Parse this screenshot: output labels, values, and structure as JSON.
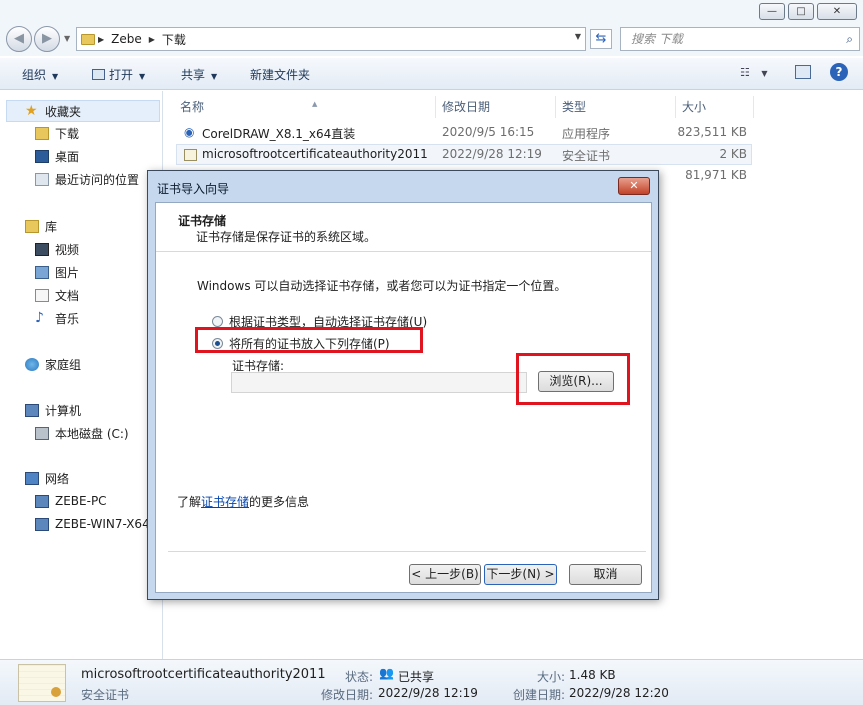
{
  "window": {
    "minimize": "—",
    "maximize": "□",
    "close": "✕"
  },
  "address": {
    "crumbs": [
      "Zebe",
      "下载"
    ],
    "search_placeholder": "搜索 下载"
  },
  "toolbar": {
    "organize": "组织",
    "open": "打开",
    "share": "共享",
    "new_folder": "新建文件夹"
  },
  "sidebar": {
    "favorites": "收藏夹",
    "downloads": "下载",
    "desktop": "桌面",
    "recent": "最近访问的位置",
    "libraries": "库",
    "videos": "视频",
    "pictures": "图片",
    "documents": "文档",
    "music": "音乐",
    "homegroup": "家庭组",
    "computer": "计算机",
    "local_disk": "本地磁盘 (C:)",
    "network": "网络",
    "pc1": "ZEBE-PC",
    "pc2": "ZEBE-WIN7-X64"
  },
  "columns": {
    "name": "名称",
    "modified": "修改日期",
    "type": "类型",
    "size": "大小"
  },
  "files": [
    {
      "name": "CorelDRAW_X8.1_x64直装",
      "modified": "2020/9/5 16:15",
      "type": "应用程序",
      "size": "823,511 KB"
    },
    {
      "name": "microsoftrootcertificateauthority2011",
      "modified": "2022/9/28 12:19",
      "type": "安全证书",
      "size": "2 KB"
    },
    {
      "name": "",
      "modified": "",
      "type": "",
      "size": "81,971 KB"
    }
  ],
  "details": {
    "filename": "microsoftrootcertificateauthority2011",
    "filetype": "安全证书",
    "status_label": "状态:",
    "status_value": "已共享",
    "size_label": "大小:",
    "size_value": "1.48 KB",
    "modified_label": "修改日期:",
    "modified_value": "2022/9/28 12:19",
    "created_label": "创建日期:",
    "created_value": "2022/9/28 12:20"
  },
  "dialog": {
    "title": "证书导入向导",
    "close": "✕",
    "header_title": "证书存储",
    "header_subtitle": "证书存储是保存证书的系统区域。",
    "intro": "Windows 可以自动选择证书存储，或者您可以为证书指定一个位置。",
    "radio_auto": "根据证书类型，自动选择证书存储(U)",
    "radio_manual": "将所有的证书放入下列存储(P)",
    "store_label": "证书存储:",
    "store_value": "",
    "browse": "浏览(R)...",
    "learn_prefix": "了解",
    "learn_link": "证书存储",
    "learn_suffix": "的更多信息",
    "back": "< 上一步(B)",
    "next": "下一步(N) >",
    "cancel": "取消"
  },
  "colors": {
    "highlight": "#e0141e",
    "accent": "#2a63b8"
  }
}
